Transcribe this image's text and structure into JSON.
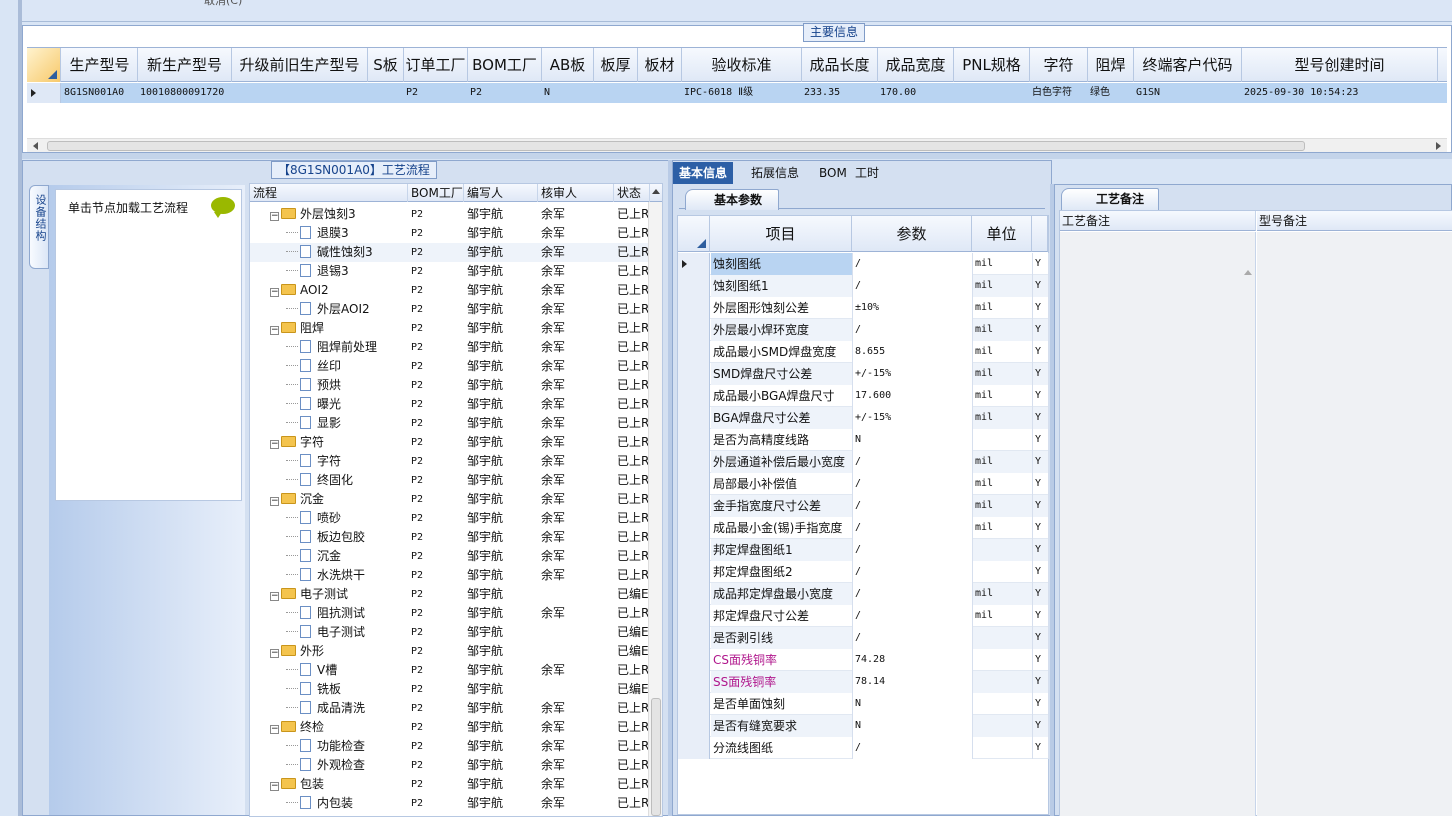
{
  "top_strip": {
    "cut_text": "取消(C)"
  },
  "main_info": {
    "title": "主要信息",
    "columns": [
      "生产型号",
      "新生产型号",
      "升级前旧生产型号",
      "S板",
      "订单工厂",
      "BOM工厂",
      "AB板",
      "板厚",
      "板材",
      "验收标准",
      "成品长度",
      "成品宽度",
      "PNL规格",
      "字符",
      "阻焊",
      "终端客户代码",
      "型号创建时间"
    ],
    "row": [
      "8G1SN001A0",
      "10010800091720",
      "",
      "",
      "P2",
      "P2",
      "N",
      "",
      "",
      "IPC-6018 Ⅱ级",
      "233.35",
      "170.00",
      "",
      "白色字符",
      "绿色",
      "G1SN",
      "2025-09-30 10:54:23"
    ]
  },
  "flow_panel": {
    "title": "【8G1SN001A0】工艺流程",
    "side_tab": "设备结构",
    "load_hint": "单击节点加载工艺流程",
    "columns": [
      "流程",
      "BOM工厂",
      "编写人",
      "核审人",
      "状态"
    ],
    "rows": [
      {
        "level": 0,
        "type": "folder",
        "name": "外层蚀刻3",
        "bom": "P2",
        "writer": "邹宇航",
        "reviewer": "余军",
        "status": "已上R"
      },
      {
        "level": 1,
        "type": "doc",
        "name": "退膜3",
        "bom": "P2",
        "writer": "邹宇航",
        "reviewer": "余军",
        "status": "已上R"
      },
      {
        "level": 1,
        "type": "doc",
        "name": "碱性蚀刻3",
        "bom": "P2",
        "writer": "邹宇航",
        "reviewer": "余军",
        "status": "已上R"
      },
      {
        "level": 1,
        "type": "doc",
        "name": "退锡3",
        "bom": "P2",
        "writer": "邹宇航",
        "reviewer": "余军",
        "status": "已上R"
      },
      {
        "level": 0,
        "type": "folder",
        "name": "AOI2",
        "bom": "P2",
        "writer": "邹宇航",
        "reviewer": "余军",
        "status": "已上R"
      },
      {
        "level": 1,
        "type": "doc",
        "name": "外层AOI2",
        "bom": "P2",
        "writer": "邹宇航",
        "reviewer": "余军",
        "status": "已上R"
      },
      {
        "level": 0,
        "type": "folder",
        "name": "阻焊",
        "bom": "P2",
        "writer": "邹宇航",
        "reviewer": "余军",
        "status": "已上R"
      },
      {
        "level": 1,
        "type": "doc",
        "name": "阻焊前处理",
        "bom": "P2",
        "writer": "邹宇航",
        "reviewer": "余军",
        "status": "已上R"
      },
      {
        "level": 1,
        "type": "doc",
        "name": "丝印",
        "bom": "P2",
        "writer": "邹宇航",
        "reviewer": "余军",
        "status": "已上R"
      },
      {
        "level": 1,
        "type": "doc",
        "name": "预烘",
        "bom": "P2",
        "writer": "邹宇航",
        "reviewer": "余军",
        "status": "已上R"
      },
      {
        "level": 1,
        "type": "doc",
        "name": "曝光",
        "bom": "P2",
        "writer": "邹宇航",
        "reviewer": "余军",
        "status": "已上R"
      },
      {
        "level": 1,
        "type": "doc",
        "name": "显影",
        "bom": "P2",
        "writer": "邹宇航",
        "reviewer": "余军",
        "status": "已上R"
      },
      {
        "level": 0,
        "type": "folder",
        "name": "字符",
        "bom": "P2",
        "writer": "邹宇航",
        "reviewer": "余军",
        "status": "已上R"
      },
      {
        "level": 1,
        "type": "doc",
        "name": "字符",
        "bom": "P2",
        "writer": "邹宇航",
        "reviewer": "余军",
        "status": "已上R"
      },
      {
        "level": 1,
        "type": "doc",
        "name": "终固化",
        "bom": "P2",
        "writer": "邹宇航",
        "reviewer": "余军",
        "status": "已上R"
      },
      {
        "level": 0,
        "type": "folder",
        "name": "沉金",
        "bom": "P2",
        "writer": "邹宇航",
        "reviewer": "余军",
        "status": "已上R"
      },
      {
        "level": 1,
        "type": "doc",
        "name": "喷砂",
        "bom": "P2",
        "writer": "邹宇航",
        "reviewer": "余军",
        "status": "已上R"
      },
      {
        "level": 1,
        "type": "doc",
        "name": "板边包胶",
        "bom": "P2",
        "writer": "邹宇航",
        "reviewer": "余军",
        "status": "已上R"
      },
      {
        "level": 1,
        "type": "doc",
        "name": "沉金",
        "bom": "P2",
        "writer": "邹宇航",
        "reviewer": "余军",
        "status": "已上R"
      },
      {
        "level": 1,
        "type": "doc",
        "name": "水洗烘干",
        "bom": "P2",
        "writer": "邹宇航",
        "reviewer": "余军",
        "status": "已上R"
      },
      {
        "level": 0,
        "type": "folder",
        "name": "电子测试",
        "bom": "P2",
        "writer": "邹宇航",
        "reviewer": "",
        "status": "已编E"
      },
      {
        "level": 1,
        "type": "doc",
        "name": "阻抗测试",
        "bom": "P2",
        "writer": "邹宇航",
        "reviewer": "余军",
        "status": "已上R"
      },
      {
        "level": 1,
        "type": "doc",
        "name": "电子测试",
        "bom": "P2",
        "writer": "邹宇航",
        "reviewer": "",
        "status": "已编E"
      },
      {
        "level": 0,
        "type": "folder",
        "name": "外形",
        "bom": "P2",
        "writer": "邹宇航",
        "reviewer": "",
        "status": "已编E"
      },
      {
        "level": 1,
        "type": "doc",
        "name": "V槽",
        "bom": "P2",
        "writer": "邹宇航",
        "reviewer": "余军",
        "status": "已上R"
      },
      {
        "level": 1,
        "type": "doc",
        "name": "铣板",
        "bom": "P2",
        "writer": "邹宇航",
        "reviewer": "",
        "status": "已编E"
      },
      {
        "level": 1,
        "type": "doc",
        "name": "成品清洗",
        "bom": "P2",
        "writer": "邹宇航",
        "reviewer": "余军",
        "status": "已上R"
      },
      {
        "level": 0,
        "type": "folder",
        "name": "终检",
        "bom": "P2",
        "writer": "邹宇航",
        "reviewer": "余军",
        "status": "已上R"
      },
      {
        "level": 1,
        "type": "doc",
        "name": "功能检查",
        "bom": "P2",
        "writer": "邹宇航",
        "reviewer": "余军",
        "status": "已上R"
      },
      {
        "level": 1,
        "type": "doc",
        "name": "外观检查",
        "bom": "P2",
        "writer": "邹宇航",
        "reviewer": "余军",
        "status": "已上R"
      },
      {
        "level": 0,
        "type": "folder",
        "name": "包装",
        "bom": "P2",
        "writer": "邹宇航",
        "reviewer": "余军",
        "status": "已上R"
      },
      {
        "level": 1,
        "type": "doc",
        "name": "内包装",
        "bom": "P2",
        "writer": "邹宇航",
        "reviewer": "余军",
        "status": "已上R"
      }
    ]
  },
  "detail_tabs": [
    "基本信息",
    "拓展信息",
    "BOM",
    "工时"
  ],
  "basic_params": {
    "subtab": "基本参数",
    "columns": [
      "项目",
      "参数",
      "单位"
    ],
    "rows": [
      {
        "item": "蚀刻图纸",
        "param": "/",
        "unit": "mil",
        "flag": "Y"
      },
      {
        "item": "蚀刻图纸1",
        "param": "/",
        "unit": "mil",
        "flag": "Y"
      },
      {
        "item": "外层图形蚀刻公差",
        "param": "±10%",
        "unit": "mil",
        "flag": "Y"
      },
      {
        "item": "外层最小焊环宽度",
        "param": "/",
        "unit": "mil",
        "flag": "Y"
      },
      {
        "item": "成品最小SMD焊盘宽度",
        "param": "8.655",
        "unit": "mil",
        "flag": "Y"
      },
      {
        "item": "SMD焊盘尺寸公差",
        "param": "+/-15%",
        "unit": "mil",
        "flag": "Y"
      },
      {
        "item": "成品最小BGA焊盘尺寸",
        "param": "17.600",
        "unit": "mil",
        "flag": "Y"
      },
      {
        "item": "BGA焊盘尺寸公差",
        "param": "+/-15%",
        "unit": "mil",
        "flag": "Y"
      },
      {
        "item": "是否为高精度线路",
        "param": "N",
        "unit": "",
        "flag": "Y"
      },
      {
        "item": "外层通道补偿后最小宽度",
        "param": "/",
        "unit": "mil",
        "flag": "Y"
      },
      {
        "item": "局部最小补偿值",
        "param": "/",
        "unit": "mil",
        "flag": "Y"
      },
      {
        "item": "金手指宽度尺寸公差",
        "param": "/",
        "unit": "mil",
        "flag": "Y"
      },
      {
        "item": "成品最小金(锡)手指宽度",
        "param": "/",
        "unit": "mil",
        "flag": "Y"
      },
      {
        "item": "邦定焊盘图纸1",
        "param": "/",
        "unit": "",
        "flag": "Y"
      },
      {
        "item": "邦定焊盘图纸2",
        "param": "/",
        "unit": "",
        "flag": "Y"
      },
      {
        "item": "成品邦定焊盘最小宽度",
        "param": "/",
        "unit": "mil",
        "flag": "Y"
      },
      {
        "item": "邦定焊盘尺寸公差",
        "param": "/",
        "unit": "mil",
        "flag": "Y"
      },
      {
        "item": "是否剥引线",
        "param": "/",
        "unit": "",
        "flag": "Y"
      },
      {
        "item": "CS面残铜率",
        "param": "74.28",
        "unit": "",
        "flag": "Y",
        "magenta": true
      },
      {
        "item": "SS面残铜率",
        "param": "78.14",
        "unit": "",
        "flag": "Y",
        "magenta": true
      },
      {
        "item": "是否单面蚀刻",
        "param": "N",
        "unit": "",
        "flag": "Y"
      },
      {
        "item": "是否有缝宽要求",
        "param": "N",
        "unit": "",
        "flag": "Y"
      },
      {
        "item": "分流线图纸",
        "param": "/",
        "unit": "",
        "flag": "Y"
      }
    ]
  },
  "process_notes": {
    "subtab": "工艺备注",
    "col1": "工艺备注",
    "col2": "型号备注"
  }
}
